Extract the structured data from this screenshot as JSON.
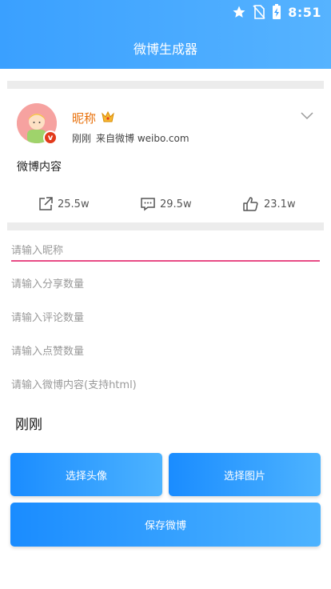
{
  "status_bar": {
    "time": "8:51",
    "icons": [
      "star-icon",
      "no-sim-icon",
      "battery-charging-icon"
    ]
  },
  "header": {
    "title": "微博生成器"
  },
  "post": {
    "nickname": "昵称",
    "time": "刚刚",
    "source": "来自微博 weibo.com",
    "content": "微博内容",
    "shares": "25.5w",
    "comments": "29.5w",
    "likes": "23.1w"
  },
  "form": {
    "nickname_placeholder": "请输入昵称",
    "share_placeholder": "请输入分享数量",
    "comment_placeholder": "请输入评论数量",
    "like_placeholder": "请输入点赞数量",
    "content_placeholder": "请输入微博内容(支持html)",
    "time_value": "刚刚"
  },
  "buttons": {
    "choose_avatar": "选择头像",
    "choose_image": "选择图片",
    "save": "保存微博"
  },
  "colors": {
    "accent": "#3aa0ff",
    "nickname": "#e8700a",
    "input_underline": "#e84c86"
  }
}
